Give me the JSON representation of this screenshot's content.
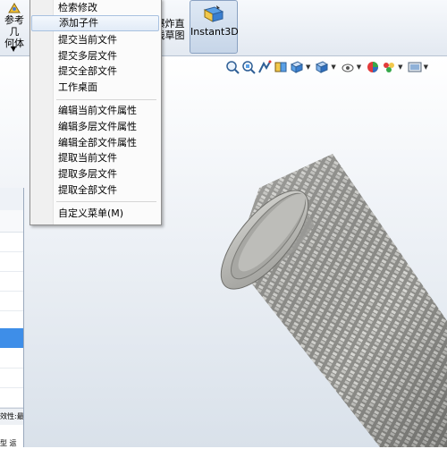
{
  "toolbar": {
    "ref_geometry_line1": "参考几",
    "ref_geometry_line2": "何体",
    "explode_line1": "爆炸直",
    "explode_line2": "线草图",
    "instant3d_label": "Instant3D"
  },
  "menu": {
    "items": [
      {
        "label": "检索修改"
      },
      {
        "label": "添加子件"
      },
      {
        "label": "提交当前文件"
      },
      {
        "label": "提交多层文件"
      },
      {
        "label": "提交全部文件"
      },
      {
        "label": "工作桌面"
      },
      {
        "label": "编辑当前文件属性"
      },
      {
        "label": "编辑多层文件属性"
      },
      {
        "label": "编辑全部文件属性"
      },
      {
        "label": "提取当前文件"
      },
      {
        "label": "提取多层文件"
      },
      {
        "label": "提取全部文件"
      },
      {
        "label": "自定义菜单(M)"
      }
    ]
  },
  "left_panel": {
    "status_text": "效性:最",
    "bottom_text": "型 运"
  },
  "view_toolbar": {
    "icons": [
      "zoom-to-fit-icon",
      "zoom-area-icon",
      "previous-view-icon",
      "section-view-icon",
      "view-orientation-icon",
      "display-style-icon",
      "hide-show-icon",
      "edit-appearance-icon",
      "apply-scene-icon",
      "view-settings-icon"
    ]
  },
  "colors": {
    "menu_highlight": "#e1ebf7",
    "selection_blue": "#3e8ee8",
    "model_gray": "#b4b4b0"
  }
}
